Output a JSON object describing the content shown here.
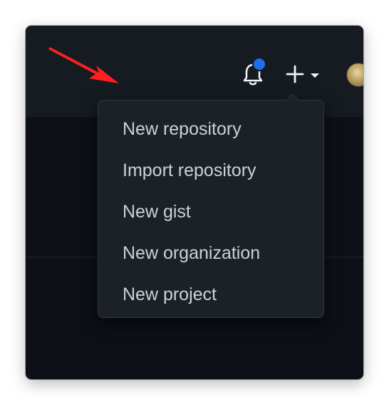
{
  "header": {
    "notifications_icon": "bell-icon",
    "notification_badge_color": "#1f6feb",
    "create_icon": "plus-icon",
    "create_dropdown_icon": "triangle-down-icon",
    "avatar_icon": "avatar"
  },
  "create_menu": {
    "items": [
      {
        "label": "New repository"
      },
      {
        "label": "Import repository"
      },
      {
        "label": "New gist"
      },
      {
        "label": "New organization"
      },
      {
        "label": "New project"
      }
    ]
  },
  "annotation": {
    "arrow_color": "#ff1f1f",
    "icon": "pointer-arrow"
  },
  "theme": {
    "background": "#0d1117",
    "header_background": "#161b22",
    "menu_background": "#1c2128",
    "menu_border": "#30363d",
    "text": "#c9d1d9"
  }
}
